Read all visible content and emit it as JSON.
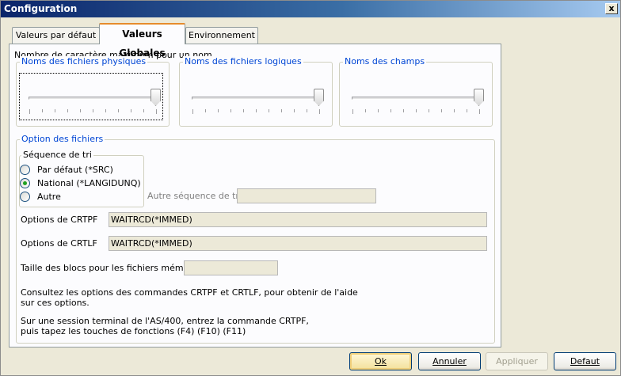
{
  "window": {
    "title": "Configuration",
    "close_glyph": "x"
  },
  "tabs": [
    {
      "label": "Valeurs par défaut"
    },
    {
      "label": "Valeurs Globales"
    },
    {
      "label": "Environnement"
    }
  ],
  "limits": {
    "heading": "Nombre de caractère maximum pour un nom",
    "sliders": [
      {
        "label": "Noms des fichiers physiques",
        "level": 1.0
      },
      {
        "label": "Noms des fichiers logiques",
        "level": 1.0
      },
      {
        "label": "Noms des champs",
        "level": 1.0
      }
    ]
  },
  "file_options": {
    "group_label": "Option des fichiers",
    "sort": {
      "label": "Séquence de tri",
      "options": [
        {
          "label": "Par défaut (*SRC)",
          "checked": false
        },
        {
          "label": "National (*LANGIDUNQ)",
          "checked": true
        },
        {
          "label": "Autre",
          "checked": false
        }
      ],
      "other_label": "Autre séquence de tri",
      "other_value": ""
    },
    "crtpf": {
      "label": "Options de CRTPF",
      "value": "WAITRCD(*IMMED)"
    },
    "crtlf": {
      "label": "Options de CRTLF",
      "value": "WAITRCD(*IMMED)"
    },
    "memo": {
      "label": "Taille des blocs pour les fichiers mémos",
      "value": ""
    },
    "help1_line1": "Consultez les options des commandes CRTPF et CRTLF, pour obtenir de l'aide",
    "help1_line2": "sur ces options.",
    "help2_line1": "Sur une session terminal de l'AS/400, entrez la commande CRTPF,",
    "help2_line2": "puis tapez les touches de fonctions (F4) (F10) (F11)"
  },
  "buttons": {
    "ok": "Ok",
    "cancel": "Annuler",
    "apply": "Appliquer",
    "default": "Defaut"
  },
  "colors": {
    "accent": "#0046d5",
    "titlebar": "#0a246a",
    "radio_checked": "#21a121"
  }
}
